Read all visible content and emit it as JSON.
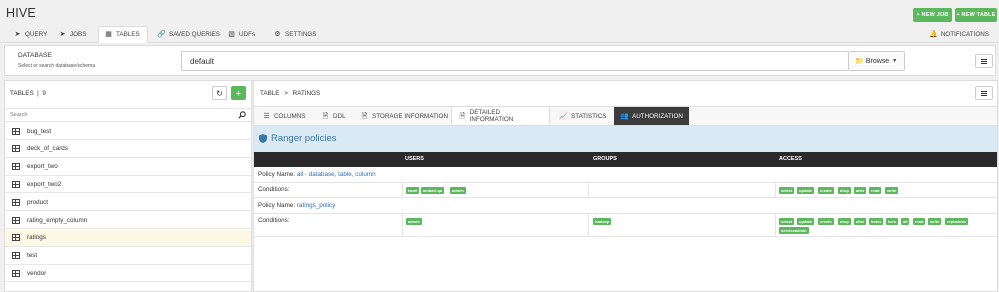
{
  "app": {
    "title": "HIVE"
  },
  "actions": {
    "new_job": "+ NEW JOB",
    "new_table": "+ NEW TABLE"
  },
  "nav": {
    "tabs": [
      {
        "label": "QUERY",
        "icon": "paper-plane-icon"
      },
      {
        "label": "JOBS",
        "icon": "send-icon"
      },
      {
        "label": "TABLES",
        "icon": "table-icon",
        "active": true
      },
      {
        "label": "SAVED QUERIES",
        "icon": "link-icon"
      },
      {
        "label": "UDFs",
        "icon": "puzzle-icon"
      },
      {
        "label": "SETTINGS",
        "icon": "gear-icon"
      }
    ],
    "notifications": "NOTIFICATIONS"
  },
  "database": {
    "label": "DATABASE",
    "hint": "Select or search database/schema",
    "value": "default",
    "browse": "Browse"
  },
  "tables": {
    "title": "TABLES",
    "count": "9",
    "search_placeholder": "Search",
    "items": [
      "bug_test",
      "deck_of_cards",
      "export_two",
      "export_two2",
      "product",
      "rating_empty_column",
      "ratings",
      "test",
      "vendor"
    ],
    "selected": "ratings"
  },
  "detail": {
    "breadcrumb_root": "TABLE",
    "breadcrumb_sep": ">",
    "breadcrumb_table": "RATINGS",
    "tabs": [
      "COLUMNS",
      "DDL",
      "STORAGE INFORMATION",
      "DETAILED INFORMATION",
      "STATISTICS",
      "AUTHORIZATION"
    ],
    "active_tab": "AUTHORIZATION"
  },
  "ranger": {
    "title": "Ranger policies",
    "columns": [
      "USERS",
      "GROUPS",
      "ACCESS"
    ],
    "policy_label": "Policy Name:",
    "conditions_label": "Conditions:",
    "policies": [
      {
        "name": "all - database, table, column",
        "users": [
          "tamil",
          "ambari-qa",
          "admin"
        ],
        "groups": [],
        "access": [
          "select",
          "update",
          "create",
          "drop",
          "alter",
          "read",
          "write"
        ]
      },
      {
        "name": "ratings_policy",
        "users": [
          "admin"
        ],
        "groups": [
          "hadoop"
        ],
        "access": [
          "select",
          "update",
          "create",
          "drop",
          "alter",
          "index",
          "lock",
          "all",
          "read",
          "write",
          "repladmin",
          "serviceadmin"
        ]
      }
    ]
  },
  "colors": {
    "green": "#5cb85c",
    "dark_header": "#2a2a2a",
    "ranger_bg": "#d9eaf5",
    "link": "#2a6fb5",
    "selected_row": "#fcf8e3"
  }
}
